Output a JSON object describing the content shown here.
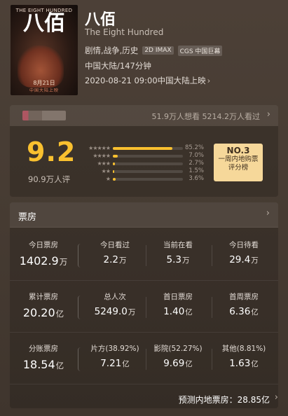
{
  "movie": {
    "poster": {
      "top_text": "THE EIGHT HUNDRED",
      "big_title": "八佰",
      "date": "8月21日",
      "subtitle": "中国大陆上映"
    },
    "title_cn": "八佰",
    "title_en": "The Eight Hundred",
    "genres": "剧情,战争,历史",
    "format_tags": [
      "2D IMAX",
      "CGS 中国巨幕"
    ],
    "region_runtime": "中国大陆/147分钟",
    "release": "2020-08-21 09:00中国大陆上映",
    "release_chevron": "›"
  },
  "want": {
    "stats": "51.9万人想看  5214.2万人看过",
    "chevron": "›",
    "blur_colors": [
      "#c45a6a",
      "#7a6b62",
      "#8e8077"
    ]
  },
  "rating": {
    "score": "9.2",
    "count": "90.9万人评",
    "distribution": [
      {
        "stars": "★★★★★",
        "percent": 85.2,
        "label": "85.2%"
      },
      {
        "stars": "★★★★",
        "percent": 7.0,
        "label": "7.0%"
      },
      {
        "stars": "★★★",
        "percent": 2.7,
        "label": "2.7%"
      },
      {
        "stars": "★★",
        "percent": 1.5,
        "label": "1.5%"
      },
      {
        "stars": "★",
        "percent": 3.6,
        "label": "3.6%"
      }
    ],
    "rank": {
      "no": "NO.3",
      "line1": "一周内地购票",
      "line2": "评分榜"
    },
    "accent": "#f9c02f"
  },
  "box_office": {
    "title": "票房",
    "chevron": "›",
    "rows": [
      [
        {
          "label": "今日票房",
          "value": "1402.9",
          "unit": "万"
        },
        {
          "label": "今日看过",
          "value": "2.2",
          "unit": "万"
        },
        {
          "label": "当前在看",
          "value": "5.3",
          "unit": "万"
        },
        {
          "label": "今日待看",
          "value": "29.4",
          "unit": "万"
        }
      ],
      [
        {
          "label": "累计票房",
          "value": "20.20",
          "unit": "亿"
        },
        {
          "label": "总人次",
          "value": "5249.0",
          "unit": "万"
        },
        {
          "label": "首日票房",
          "value": "1.40",
          "unit": "亿"
        },
        {
          "label": "首周票房",
          "value": "6.36",
          "unit": "亿"
        }
      ],
      [
        {
          "label": "分账票房",
          "value": "18.54",
          "unit": "亿"
        },
        {
          "label": "片方(38.92%)",
          "value": "7.21",
          "unit": "亿"
        },
        {
          "label": "影院(52.27%)",
          "value": "9.69",
          "unit": "亿"
        },
        {
          "label": "其他(8.81%)",
          "value": "1.63",
          "unit": "亿"
        }
      ]
    ],
    "forecast": "预测内地票房：28.85亿",
    "forecast_chevron": "›"
  }
}
